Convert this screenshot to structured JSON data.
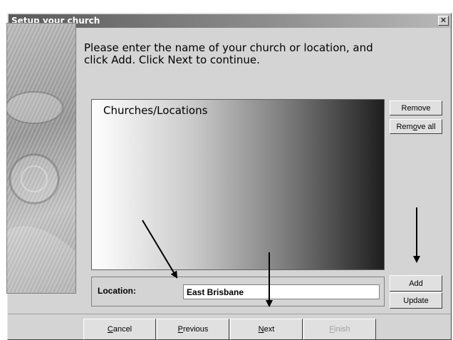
{
  "window": {
    "title": "Setup your church",
    "close_icon": "close-icon"
  },
  "instructions": "Please enter the name of your church or location, and click Add. Click Next to continue.",
  "list": {
    "header": "Churches/Locations",
    "items": []
  },
  "side_buttons": {
    "remove": "Remove",
    "remove_all": "Remove all"
  },
  "entry_buttons": {
    "add": "Add",
    "update": "Update"
  },
  "location": {
    "label": "Location:",
    "value": "East Brisbane"
  },
  "footer": {
    "cancel": "Cancel",
    "previous": "Previous",
    "next": "Next",
    "finish": "Finish"
  },
  "colors": {
    "dialog_bg": "#d4d4d4",
    "title_bar_start": "#5a5a5a"
  }
}
